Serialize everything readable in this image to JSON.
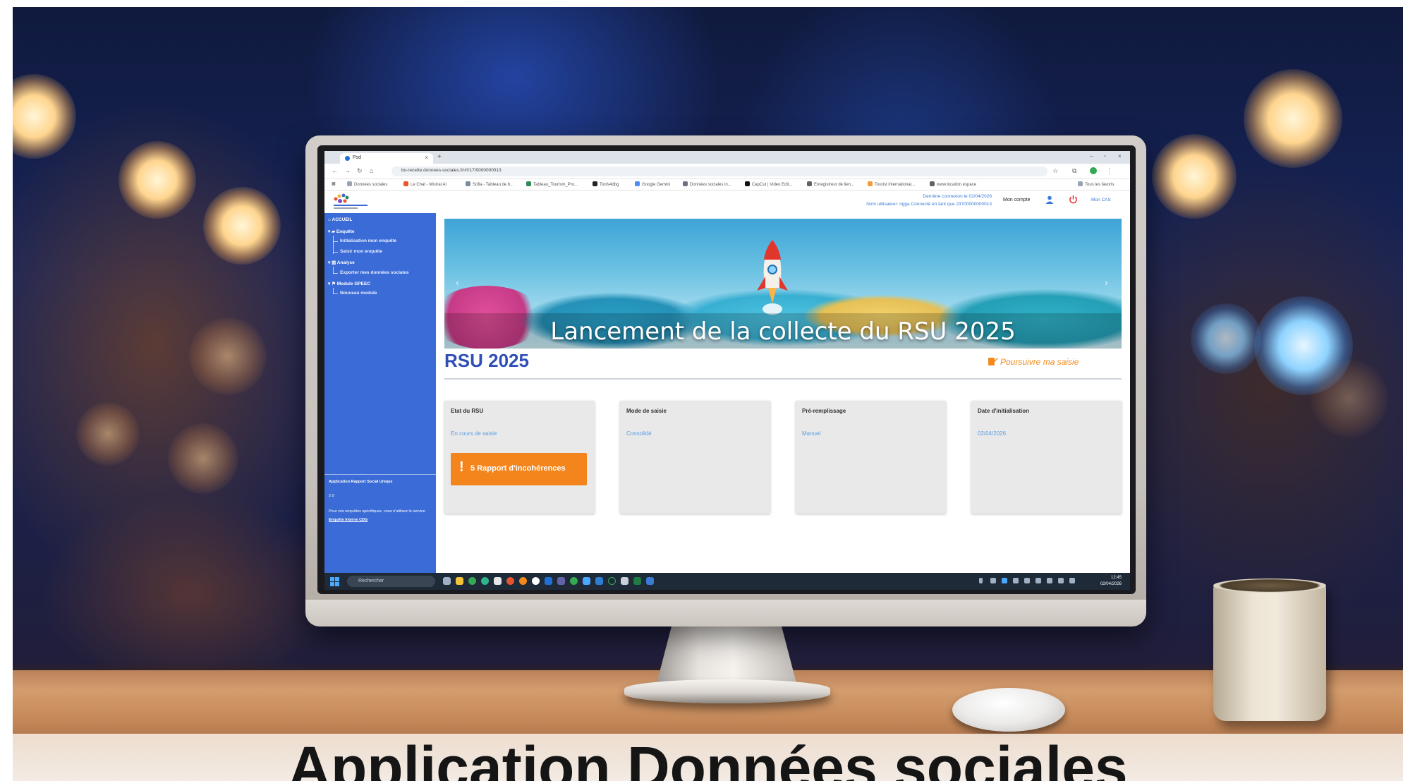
{
  "caption": "Application Données sociales",
  "browser": {
    "tab_title": "Psd",
    "url": "bo-recette.donnees-sociales.fr/#!/17/0000000013",
    "bookmarks": [
      "Données sociales",
      "Le Chat - Mistral AI",
      "Sofia - Tableau de b...",
      "Tableau_Tourism_Pro...",
      "Tools4dbg",
      "Google Gemini",
      "Données sociales in...",
      "CapCut | Video Edit...",
      "Enregistreur de lien...",
      "Tourist international...",
      "www.location.espace"
    ],
    "all_bookmarks": "Tous les favoris"
  },
  "header": {
    "last_login": "Dernière connexion le 02/04/2026",
    "user_line": "Nom utilisateur: rigga Connecté en tant que 23700000000013",
    "account_label": "Mon compte",
    "cas_label": "Mon CAS"
  },
  "sidebar": {
    "home": "ACCUEIL",
    "survey": "Enquête",
    "survey_items": [
      "Initialisation mon enquête",
      "Saisir mon enquête"
    ],
    "analysis": "Analyse",
    "analysis_items": [
      "Exporter mes données sociales"
    ],
    "gpeec": "Module GPEEC",
    "gpeec_items": [
      "Nouveau module"
    ],
    "footer_app": "Application Rapport Social Unique",
    "footer_version": "2.0",
    "footer_help": "Pour vos enquêtes spécifiques, vous n'utilisez le service",
    "footer_link": "Enquête Interne CDG"
  },
  "main": {
    "banner_text": "Lancement de la collecte du RSU 2025",
    "title": "RSU 2025",
    "continue_label": "Poursuivre ma saisie",
    "cards": [
      {
        "label": "Etat du RSU",
        "value": "En cours de saisie"
      },
      {
        "label": "Mode de saisie",
        "value": "Consolidé"
      },
      {
        "label": "Pré-remplissage",
        "value": "Manuel"
      },
      {
        "label": "Date d'initialisation",
        "value": "02/04/2026"
      }
    ],
    "report_count": "5",
    "report_label": "Rapport d'incohérences"
  },
  "taskbar": {
    "search_placeholder": "Rechercher",
    "time": "12:45",
    "date": "02/04/2026"
  },
  "colors": {
    "sidebar": "#3b6bd6",
    "accent_orange": "#f4841c",
    "title_blue": "#2f4fb5",
    "link_blue": "#5b9de0"
  }
}
